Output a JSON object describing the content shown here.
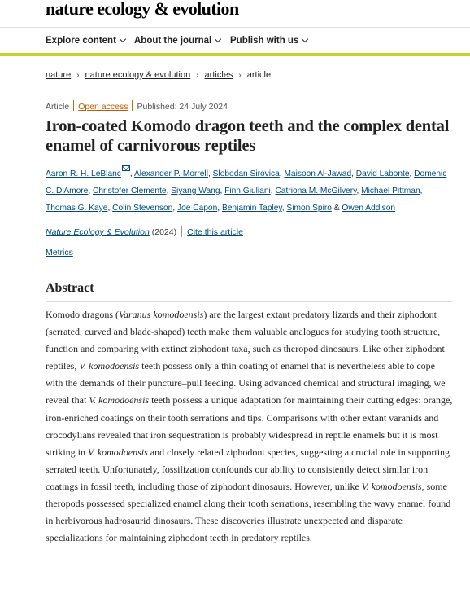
{
  "header": {
    "journal_title": "nature ecology & evolution"
  },
  "nav": {
    "items": [
      {
        "label": "Explore content"
      },
      {
        "label": "About the journal"
      },
      {
        "label": "Publish with us"
      }
    ]
  },
  "breadcrumb": {
    "items": [
      "nature",
      "nature ecology & evolution",
      "articles"
    ],
    "current": "article"
  },
  "meta": {
    "type": "Article",
    "access": "Open access",
    "published": "Published: 24 July 2024"
  },
  "article": {
    "title": "Iron-coated Komodo dragon teeth and the complex dental enamel of carnivorous reptiles"
  },
  "authors": {
    "names": [
      "Aaron R. H. LeBlanc",
      "Alexander P. Morrell",
      "Slobodan Sirovica",
      "Maisoon Al-Jawad",
      "David Labonte",
      "Domenic C. D'Amore",
      "Christofer Clemente",
      "Siyang Wang",
      "Finn Giuliani",
      "Catriona M. McGilvery",
      "Michael Pittman",
      "Thomas G. Kaye",
      "Colin Stevenson",
      "Joe Capon",
      "Benjamin Tapley",
      "Simon Spiro",
      "Owen Addison"
    ],
    "separator": ", ",
    "last_joiner": " & "
  },
  "citation": {
    "journal": "Nature Ecology & Evolution",
    "year": " (2024)",
    "cite_label": "Cite this article"
  },
  "metrics_label": "Metrics",
  "abstract": {
    "heading": "Abstract",
    "segments": [
      {
        "t": "Komodo dragons ("
      },
      {
        "t": "Varanus komodoensis",
        "i": true
      },
      {
        "t": ") are the largest extant predatory lizards and their ziphodont (serrated, curved and blade-shaped) teeth make them valuable analogues for studying tooth structure, function and comparing with extinct ziphodont taxa, such as theropod dinosaurs. Like other ziphodont reptiles, "
      },
      {
        "t": "V. komodoensis",
        "i": true
      },
      {
        "t": " teeth possess only a thin coating of enamel that is nevertheless able to cope with the demands of their puncture–pull feeding. Using advanced chemical and structural imaging, we reveal that "
      },
      {
        "t": "V. komodoensis",
        "i": true
      },
      {
        "t": " teeth possess a unique adaptation for maintaining their cutting edges: orange, iron-enriched coatings on their tooth serrations and tips. Comparisons with other extant varanids and crocodylians revealed that iron sequestration is probably widespread in reptile enamels but it is most striking in "
      },
      {
        "t": "V. komodoensis",
        "i": true
      },
      {
        "t": " and closely related ziphodont species, suggesting a crucial role in supporting serrated teeth. Unfortunately, fossilization confounds our ability to consistently detect similar iron coatings in fossil teeth, including those of ziphodont dinosaurs. However, unlike "
      },
      {
        "t": "V. komodoensis",
        "i": true
      },
      {
        "t": ", some theropods possessed specialized enamel along their tooth serrations, resembling the wavy enamel found in herbivorous hadrosaurid dinosaurs. These discoveries illustrate unexpected and disparate specializations for maintaining ziphodont teeth in predatory reptiles."
      }
    ]
  },
  "colors": {
    "accent_bar": "#c5d22e",
    "link": "#004a80",
    "open_access": "#c05800"
  }
}
